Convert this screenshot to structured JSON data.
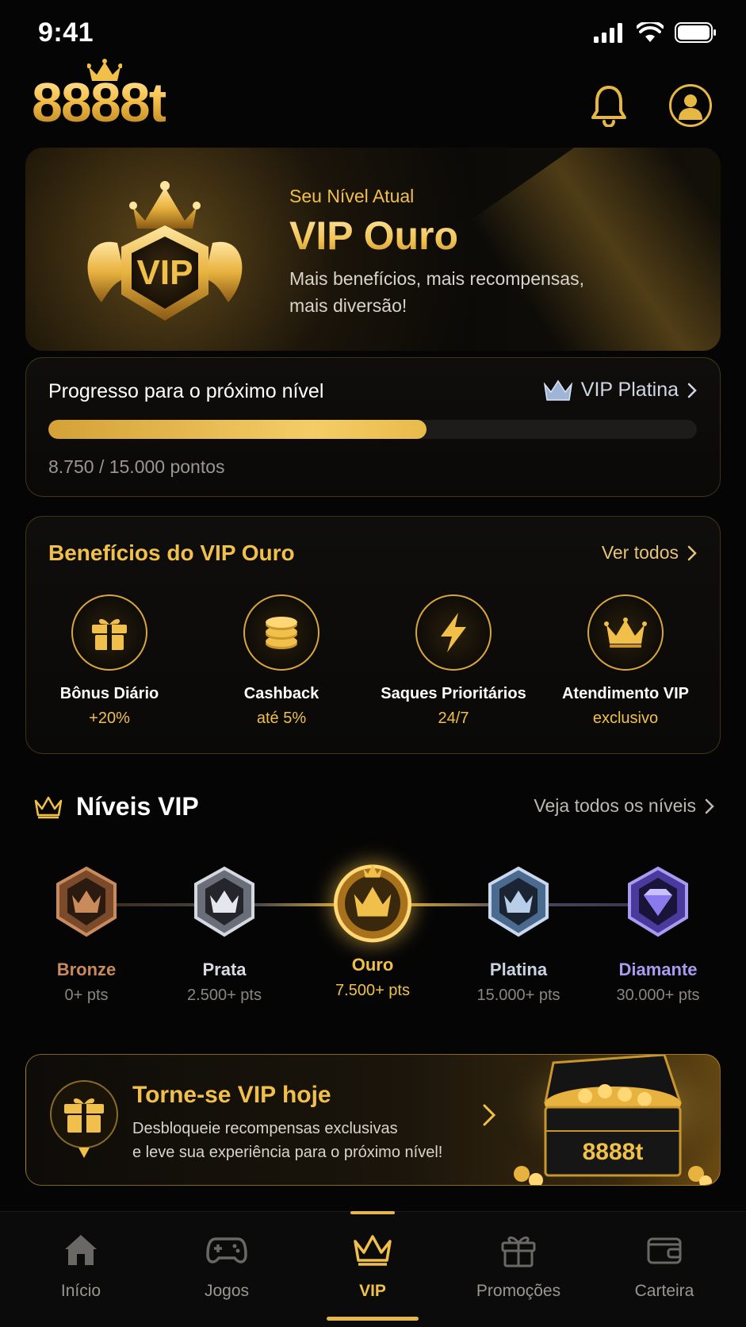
{
  "status_bar": {
    "time": "9:41"
  },
  "header": {
    "logo_text": "8888t"
  },
  "hero": {
    "label": "Seu Nível Atual",
    "title": "VIP Ouro",
    "subtitle": "Mais benefícios, mais recompensas, mais diversão!",
    "badge_text": "VIP"
  },
  "progress": {
    "title": "Progresso para o próximo nível",
    "next_level": "VIP Platina",
    "current_points": 8750,
    "target_points": 15000,
    "fraction": 0.583,
    "points_text": "8.750 / 15.000 pontos"
  },
  "benefits": {
    "title": "Benefícios do VIP Ouro",
    "see_all": "Ver todos",
    "items": [
      {
        "icon": "gift-icon",
        "name": "Bônus Diário",
        "value": "+20%"
      },
      {
        "icon": "coins-icon",
        "name": "Cashback",
        "value": "até 5%"
      },
      {
        "icon": "lightning-icon",
        "name": "Saques Prioritários",
        "value": "24/7"
      },
      {
        "icon": "crown-icon",
        "name": "Atendimento VIP",
        "value": "exclusivo"
      }
    ]
  },
  "levels": {
    "title": "Níveis VIP",
    "see_all": "Veja todos os níveis",
    "items": [
      {
        "name": "Bronze",
        "points": "0+ pts",
        "color": "#c98a5c"
      },
      {
        "name": "Prata",
        "points": "2.500+ pts",
        "color": "#c9ccd4"
      },
      {
        "name": "Ouro",
        "points": "7.500+ pts",
        "color": "#f0c04a"
      },
      {
        "name": "Platina",
        "points": "15.000+ pts",
        "color": "#c8d4e4"
      },
      {
        "name": "Diamante",
        "points": "30.000+ pts",
        "color": "#a99cf0"
      }
    ]
  },
  "promo": {
    "title": "Torne-se VIP hoje",
    "text_line1": "Desbloqueie recompensas exclusivas",
    "text_line2": "e leve sua experiência para o próximo nível!",
    "chest_text": "8888t"
  },
  "tabs": [
    {
      "icon": "home-icon",
      "label": "Início"
    },
    {
      "icon": "gamepad-icon",
      "label": "Jogos"
    },
    {
      "icon": "crown-icon",
      "label": "VIP",
      "active": true
    },
    {
      "icon": "gift-icon",
      "label": "Promoções"
    },
    {
      "icon": "wallet-icon",
      "label": "Carteira"
    }
  ],
  "colors": {
    "accent": "#f0c04a",
    "background": "#050505"
  }
}
